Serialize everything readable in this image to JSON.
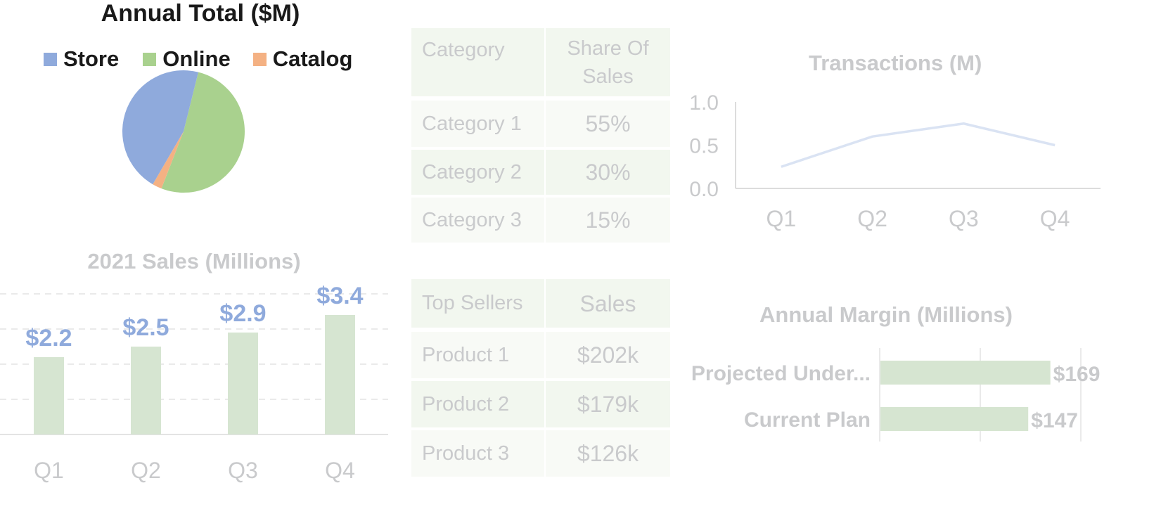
{
  "chart_data": [
    {
      "id": "annual-total",
      "type": "pie",
      "title": "Annual Total ($M)",
      "legend_position": "top",
      "labels": [
        "Store",
        "Online",
        "Catalog"
      ],
      "values_estimated_share": [
        45.5,
        52.0,
        2.5
      ],
      "colors": [
        "#8faadc",
        "#a9d18e",
        "#f4b183"
      ],
      "data_labels": false
    },
    {
      "id": "sales-2021",
      "type": "bar",
      "title": "2021 Sales (Millions)",
      "categories": [
        "Q1",
        "Q2",
        "Q3",
        "Q4"
      ],
      "values": [
        2.2,
        2.5,
        2.9,
        3.4
      ],
      "data_labels": [
        "$2.2",
        "$2.5",
        "$2.9",
        "$3.4"
      ],
      "ylim": [
        0,
        4
      ],
      "gridlines": [
        1,
        2,
        3,
        4
      ],
      "grid": true,
      "bar_color": "#d6e5d1",
      "label_color": "#8faadc",
      "xlabel": "",
      "ylabel": ""
    },
    {
      "id": "category-share",
      "type": "table",
      "columns": [
        "Category",
        "Share Of Sales"
      ],
      "rows": [
        [
          "Category 1",
          "55%"
        ],
        [
          "Category 2",
          "30%"
        ],
        [
          "Category 3",
          "15%"
        ]
      ]
    },
    {
      "id": "top-sellers",
      "type": "table",
      "columns": [
        "Top Sellers",
        "Sales"
      ],
      "rows": [
        [
          "Product 1",
          "$202k"
        ],
        [
          "Product 2",
          "$179k"
        ],
        [
          "Product 3",
          "$126k"
        ]
      ]
    },
    {
      "id": "transactions",
      "type": "line",
      "title": "Transactions (M)",
      "categories": [
        "Q1",
        "Q2",
        "Q3",
        "Q4"
      ],
      "values": [
        0.25,
        0.6,
        0.75,
        0.5
      ],
      "ylim": [
        0,
        1.0
      ],
      "yticks": [
        "0.0",
        "0.5",
        "1.0"
      ],
      "grid": false,
      "line_color": "#dae3f3"
    },
    {
      "id": "annual-margin",
      "type": "bar",
      "orientation": "horizontal",
      "title": "Annual Margin (Millions)",
      "categories": [
        "Projected Under...",
        "Current Plan"
      ],
      "values": [
        169,
        147
      ],
      "data_labels": [
        "$169",
        "$147"
      ],
      "xlim": [
        0,
        200
      ],
      "gridlines": [
        0,
        100,
        200
      ],
      "grid": true,
      "bar_color": "#d6e5d1"
    }
  ]
}
